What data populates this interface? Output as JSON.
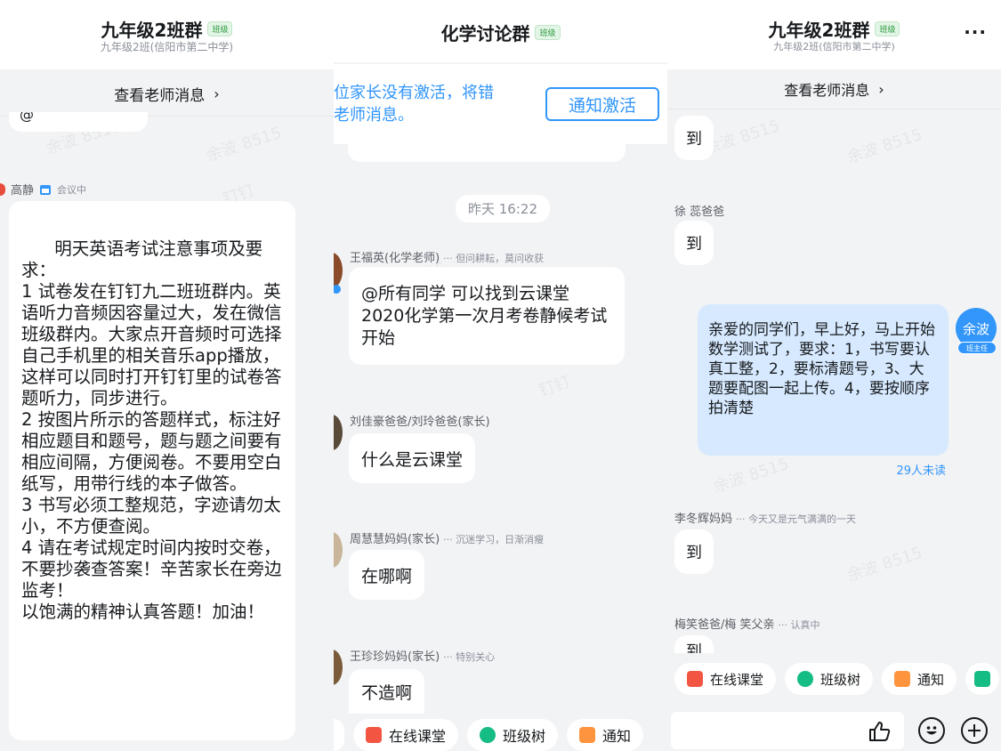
{
  "panel1": {
    "header": {
      "title": "九年级2班群",
      "badge": "班级",
      "subtitle": "九年级2班(信阳市第二中学)"
    },
    "view_teacher": {
      "label": "查看老师消息",
      "chevron": "›"
    },
    "partial_bubble_text": "@",
    "sender": {
      "name": "高静",
      "status_icon": "calendar-icon",
      "status": "会议中"
    },
    "message": "明天英语考试注意事项及要求：\n1 试卷发在钉钉九二班班群内。英语听力音频因容量过大，发在微信班级群内。大家点开音频时可选择自己手机里的相关音乐app播放，这样可以同时打开钉钉里的试卷答题听力，同步进行。\n2 按图片所示的答题样式，标注好相应题目和题号，题与题之间要有相应间隔，方便阅卷。不要用空白纸写，用带行线的本子做答。\n3 书写必须工整规范，字迹请勿太小，不方便查阅。\n4 请在考试规定时间内按时交卷，不要抄袭查答案！辛苦家长在旁边监考！\n以饱满的精神认真答题！加油！"
  },
  "panel2": {
    "header": {
      "title": "化学讨论群",
      "badge": "班级"
    },
    "activation": {
      "text": "位家长没有激活，将错\n老师消息。",
      "button": "通知激活"
    },
    "timestamp": "昨天 16:22",
    "messages": [
      {
        "sender": "王福英(化学老师)",
        "signature": "··· 但问耕耘，莫问收获",
        "text": "@所有同学  可以找到云课堂2020化学第一次月考卷静候考试开始"
      },
      {
        "sender": "刘佳豪爸爸/刘玲爸爸(家长)",
        "signature": "",
        "text": "什么是云课堂"
      },
      {
        "sender": "周慧慧妈妈(家长)",
        "signature": "··· 沉迷学习，日渐消瘦",
        "text": "在哪啊"
      },
      {
        "sender": "王珍珍妈妈(家长)",
        "signature": "··· 特别关心",
        "text": "不造啊"
      }
    ],
    "actions": [
      "在线课堂",
      "班级树",
      "通知"
    ]
  },
  "panel3": {
    "header": {
      "title": "九年级2班群",
      "badge": "班级",
      "subtitle": "九年级2班(信阳市第二中学)",
      "more": "···"
    },
    "view_teacher": {
      "label": "查看老师消息",
      "chevron": "›"
    },
    "messages": [
      {
        "sender": "",
        "signature": "",
        "text": "到"
      },
      {
        "sender": "徐 蕊爸爸",
        "signature": "",
        "text": "到"
      },
      {
        "sender": "李冬辉妈妈",
        "signature": "··· 今天又是元气满满的一天",
        "text": "到"
      },
      {
        "sender": "梅笑爸爸/梅  笑父亲",
        "signature": "··· 认真中",
        "text": "到"
      }
    ],
    "self_message": {
      "text": "亲爱的同学们，早上好，马上开始数学测试了，要求：1，书写要认真工整，2，要标清题号，3、大题要配图一起上传。4，要按顺序拍清楚",
      "unread": "29人未读",
      "avatar_name": "余波",
      "role": "班主任"
    },
    "actions": [
      "在线课堂",
      "班级树",
      "通知"
    ]
  },
  "watermarks": [
    "余波 8515",
    "钉钉"
  ],
  "colors": {
    "accent": "#3296fa",
    "self_bubble": "#d6e9ff",
    "background": "#f2f3f5"
  }
}
